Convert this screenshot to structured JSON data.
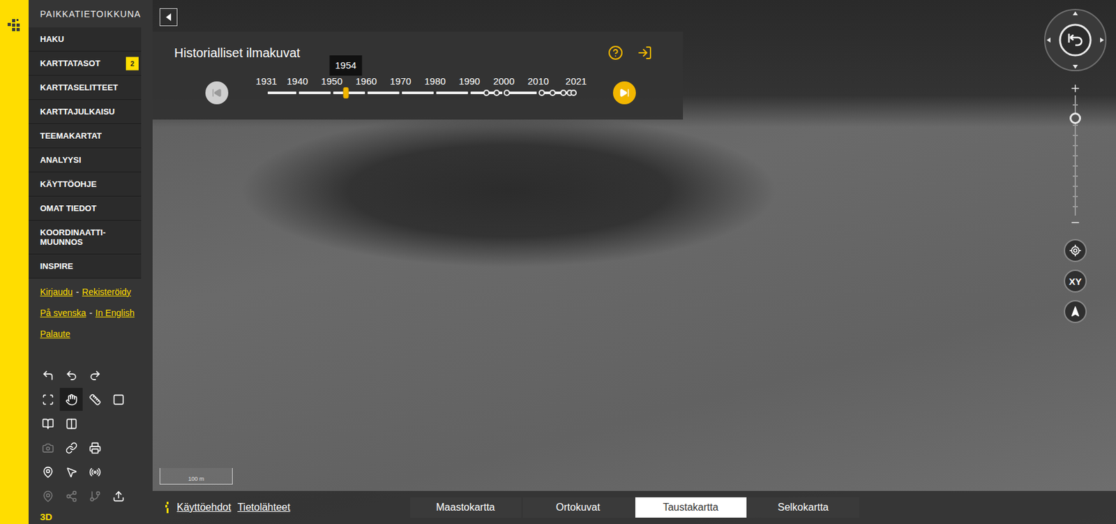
{
  "app": {
    "title": "PAIKKATIETOIKKUNA"
  },
  "menu": [
    {
      "label": "HAKU",
      "badge": ""
    },
    {
      "label": "KARTTATASOT",
      "badge": "2"
    },
    {
      "label": "KARTTASELITTEET",
      "badge": ""
    },
    {
      "label": "KARTTAJULKAISU",
      "badge": ""
    },
    {
      "label": "TEEMAKARTAT",
      "badge": ""
    },
    {
      "label": "ANALYYSI",
      "badge": ""
    },
    {
      "label": "KÄYTTÖOHJE",
      "badge": ""
    },
    {
      "label": "OMAT TIEDOT",
      "badge": ""
    },
    {
      "label": "KOORDINAATTI-MUUNNOS",
      "badge": ""
    },
    {
      "label": "INSPIRE",
      "badge": ""
    }
  ],
  "link_rows": [
    [
      {
        "text": "Kirjaudu",
        "kind": "link"
      },
      {
        "text": "-",
        "kind": "separator"
      },
      {
        "text": "Rekisteröidy",
        "kind": "link"
      }
    ],
    [
      {
        "text": "På svenska",
        "kind": "link"
      },
      {
        "text": "-",
        "kind": "separator"
      },
      {
        "text": "In English",
        "kind": "link"
      }
    ],
    [
      {
        "text": "Palaute",
        "kind": "link"
      }
    ]
  ],
  "tools": [
    [
      {
        "selected": false,
        "disabled": false
      },
      {
        "selected": false,
        "disabled": false
      },
      {
        "selected": false,
        "disabled": false
      }
    ],
    [
      {
        "selected": false,
        "disabled": false
      },
      {
        "selected": true,
        "disabled": false
      },
      {
        "selected": false,
        "disabled": false
      },
      {
        "selected": false,
        "disabled": false
      }
    ],
    [
      {
        "selected": false,
        "disabled": false
      },
      {
        "selected": false,
        "disabled": false
      }
    ],
    [
      {
        "selected": false,
        "disabled": true
      },
      {
        "selected": false,
        "disabled": false
      },
      {
        "selected": false,
        "disabled": false
      }
    ],
    [
      {
        "selected": false,
        "disabled": false
      },
      {
        "selected": false,
        "disabled": false
      },
      {
        "selected": false,
        "disabled": false
      }
    ],
    [
      {
        "selected": false,
        "disabled": true
      },
      {
        "selected": false,
        "disabled": true
      },
      {
        "selected": false,
        "disabled": true
      },
      {
        "selected": false,
        "disabled": false
      }
    ]
  ],
  "mode_3d": "3D",
  "panel": {
    "title": "Historialliset ilmakuvat",
    "years": [
      "1931",
      "1940",
      "1950",
      "1960",
      "1970",
      "1980",
      "1990",
      "2000",
      "2010",
      "2021"
    ],
    "slider": {
      "level": 0.256,
      "tooltip": "1954"
    },
    "markers": [
      0.71,
      0.743,
      0.777,
      0.89,
      0.924,
      0.959,
      0.979,
      0.991
    ],
    "prev": {
      "disabled": true
    },
    "next": {
      "disabled": false
    }
  },
  "map_controls": {
    "zoom": {
      "level": 0.81
    },
    "coordinates_button": "XY"
  },
  "scale_bar": "100 m",
  "footer_links": [
    "Käyttöehdot",
    "Tietolähteet"
  ],
  "base_maps": [
    {
      "label": "Maastokartta",
      "selected": false
    },
    {
      "label": "Ortokuvat",
      "selected": false
    },
    {
      "label": "Taustakartta",
      "selected": true
    },
    {
      "label": "Selkokartta",
      "selected": false
    }
  ]
}
